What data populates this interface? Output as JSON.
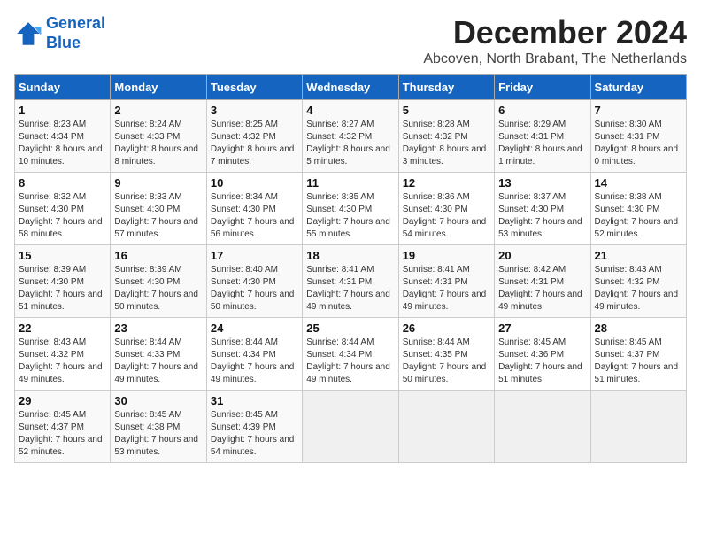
{
  "header": {
    "logo_line1": "General",
    "logo_line2": "Blue",
    "month": "December 2024",
    "location": "Abcoven, North Brabant, The Netherlands"
  },
  "weekdays": [
    "Sunday",
    "Monday",
    "Tuesday",
    "Wednesday",
    "Thursday",
    "Friday",
    "Saturday"
  ],
  "weeks": [
    [
      {
        "day": 1,
        "sunrise": "8:23 AM",
        "sunset": "4:34 PM",
        "daylight": "8 hours and 10 minutes."
      },
      {
        "day": 2,
        "sunrise": "8:24 AM",
        "sunset": "4:33 PM",
        "daylight": "8 hours and 8 minutes."
      },
      {
        "day": 3,
        "sunrise": "8:25 AM",
        "sunset": "4:32 PM",
        "daylight": "8 hours and 7 minutes."
      },
      {
        "day": 4,
        "sunrise": "8:27 AM",
        "sunset": "4:32 PM",
        "daylight": "8 hours and 5 minutes."
      },
      {
        "day": 5,
        "sunrise": "8:28 AM",
        "sunset": "4:32 PM",
        "daylight": "8 hours and 3 minutes."
      },
      {
        "day": 6,
        "sunrise": "8:29 AM",
        "sunset": "4:31 PM",
        "daylight": "8 hours and 1 minute."
      },
      {
        "day": 7,
        "sunrise": "8:30 AM",
        "sunset": "4:31 PM",
        "daylight": "8 hours and 0 minutes."
      }
    ],
    [
      {
        "day": 8,
        "sunrise": "8:32 AM",
        "sunset": "4:30 PM",
        "daylight": "7 hours and 58 minutes."
      },
      {
        "day": 9,
        "sunrise": "8:33 AM",
        "sunset": "4:30 PM",
        "daylight": "7 hours and 57 minutes."
      },
      {
        "day": 10,
        "sunrise": "8:34 AM",
        "sunset": "4:30 PM",
        "daylight": "7 hours and 56 minutes."
      },
      {
        "day": 11,
        "sunrise": "8:35 AM",
        "sunset": "4:30 PM",
        "daylight": "7 hours and 55 minutes."
      },
      {
        "day": 12,
        "sunrise": "8:36 AM",
        "sunset": "4:30 PM",
        "daylight": "7 hours and 54 minutes."
      },
      {
        "day": 13,
        "sunrise": "8:37 AM",
        "sunset": "4:30 PM",
        "daylight": "7 hours and 53 minutes."
      },
      {
        "day": 14,
        "sunrise": "8:38 AM",
        "sunset": "4:30 PM",
        "daylight": "7 hours and 52 minutes."
      }
    ],
    [
      {
        "day": 15,
        "sunrise": "8:39 AM",
        "sunset": "4:30 PM",
        "daylight": "7 hours and 51 minutes."
      },
      {
        "day": 16,
        "sunrise": "8:39 AM",
        "sunset": "4:30 PM",
        "daylight": "7 hours and 50 minutes."
      },
      {
        "day": 17,
        "sunrise": "8:40 AM",
        "sunset": "4:30 PM",
        "daylight": "7 hours and 50 minutes."
      },
      {
        "day": 18,
        "sunrise": "8:41 AM",
        "sunset": "4:31 PM",
        "daylight": "7 hours and 49 minutes."
      },
      {
        "day": 19,
        "sunrise": "8:41 AM",
        "sunset": "4:31 PM",
        "daylight": "7 hours and 49 minutes."
      },
      {
        "day": 20,
        "sunrise": "8:42 AM",
        "sunset": "4:31 PM",
        "daylight": "7 hours and 49 minutes."
      },
      {
        "day": 21,
        "sunrise": "8:43 AM",
        "sunset": "4:32 PM",
        "daylight": "7 hours and 49 minutes."
      }
    ],
    [
      {
        "day": 22,
        "sunrise": "8:43 AM",
        "sunset": "4:32 PM",
        "daylight": "7 hours and 49 minutes."
      },
      {
        "day": 23,
        "sunrise": "8:44 AM",
        "sunset": "4:33 PM",
        "daylight": "7 hours and 49 minutes."
      },
      {
        "day": 24,
        "sunrise": "8:44 AM",
        "sunset": "4:34 PM",
        "daylight": "7 hours and 49 minutes."
      },
      {
        "day": 25,
        "sunrise": "8:44 AM",
        "sunset": "4:34 PM",
        "daylight": "7 hours and 49 minutes."
      },
      {
        "day": 26,
        "sunrise": "8:44 AM",
        "sunset": "4:35 PM",
        "daylight": "7 hours and 50 minutes."
      },
      {
        "day": 27,
        "sunrise": "8:45 AM",
        "sunset": "4:36 PM",
        "daylight": "7 hours and 51 minutes."
      },
      {
        "day": 28,
        "sunrise": "8:45 AM",
        "sunset": "4:37 PM",
        "daylight": "7 hours and 51 minutes."
      }
    ],
    [
      {
        "day": 29,
        "sunrise": "8:45 AM",
        "sunset": "4:37 PM",
        "daylight": "7 hours and 52 minutes."
      },
      {
        "day": 30,
        "sunrise": "8:45 AM",
        "sunset": "4:38 PM",
        "daylight": "7 hours and 53 minutes."
      },
      {
        "day": 31,
        "sunrise": "8:45 AM",
        "sunset": "4:39 PM",
        "daylight": "7 hours and 54 minutes."
      },
      null,
      null,
      null,
      null
    ]
  ]
}
